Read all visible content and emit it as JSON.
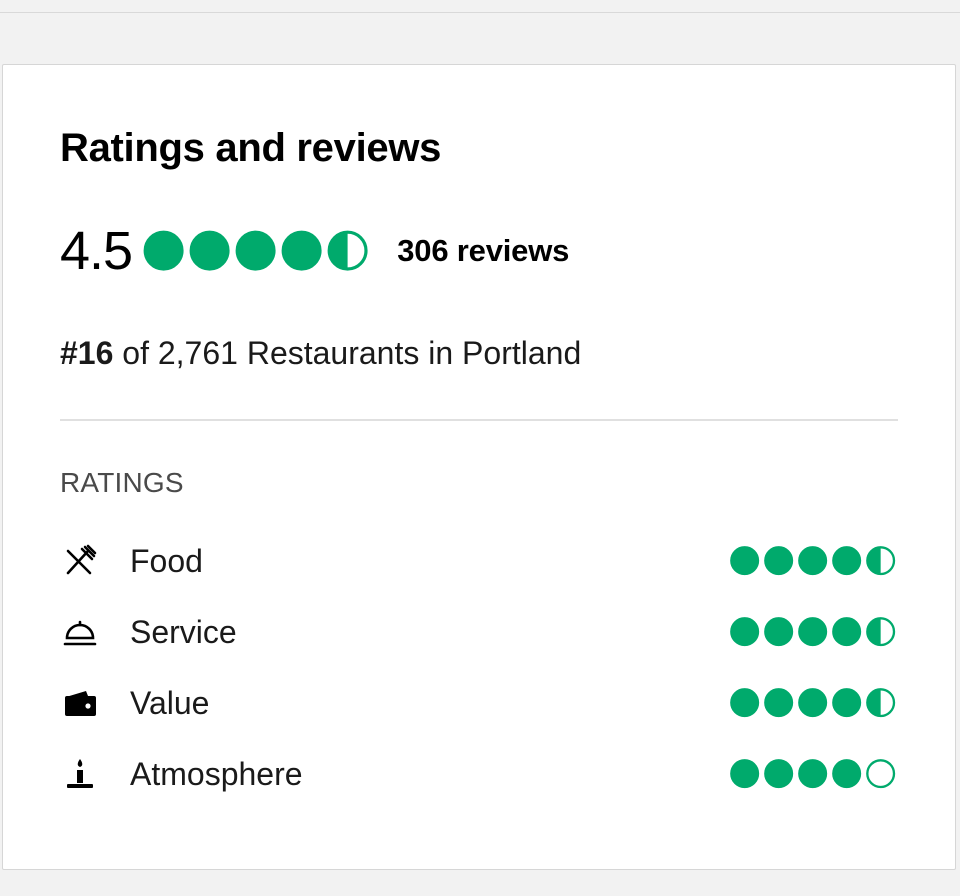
{
  "card": {
    "title": "Ratings and reviews",
    "overall": {
      "score": "4.5",
      "bubble_rating": 4.5,
      "reviews_label": "306 reviews"
    },
    "ranking": {
      "rank": "#16",
      "rest": " of 2,761 Restaurants in Portland"
    },
    "ratings_heading": "RATINGS",
    "categories": [
      {
        "label": "Food",
        "icon": "fork-knife-icon",
        "rating": 4.5
      },
      {
        "label": "Service",
        "icon": "service-bell-icon",
        "rating": 4.5
      },
      {
        "label": "Value",
        "icon": "wallet-icon",
        "rating": 4.5
      },
      {
        "label": "Atmosphere",
        "icon": "candle-icon",
        "rating": 4
      }
    ]
  },
  "colors": {
    "bubble": "#00aa6c",
    "text": "#000000",
    "muted": "#4a4a4a"
  }
}
